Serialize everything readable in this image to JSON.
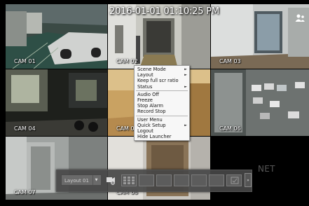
{
  "timestamp": "2016-01-01 01:10:25 PM",
  "cameras": [
    {
      "label": "CAM 01"
    },
    {
      "label": "CAM 02"
    },
    {
      "label": "CAM 03"
    },
    {
      "label": "CAM 04"
    },
    {
      "label": "CAM 05"
    },
    {
      "label": "CAM 06"
    },
    {
      "label": "CAM 07"
    },
    {
      "label": "CAM 08"
    }
  ],
  "context_menu": {
    "items": [
      {
        "label": "Scene Mode",
        "submenu": true
      },
      {
        "label": "Layout",
        "submenu": true
      },
      {
        "label": "Keep full scr ratio",
        "submenu": false
      },
      {
        "label": "Status",
        "submenu": true
      },
      {
        "label": "Audio Off",
        "submenu": false
      },
      {
        "label": "Freeze",
        "submenu": false
      },
      {
        "label": "Stop Alarm",
        "submenu": false
      },
      {
        "label": "Record Stop",
        "submenu": false
      },
      {
        "label": "User Menu",
        "submenu": false
      },
      {
        "label": "Quick Setup",
        "submenu": true
      },
      {
        "label": "Logout",
        "submenu": false
      },
      {
        "label": "Hide Launcher",
        "submenu": false
      }
    ],
    "submenu_arrow": "►"
  },
  "launcher": {
    "layout_value": "Layout 01",
    "expand_label": "»"
  },
  "watermark": "NET",
  "icons": [
    "user-icon",
    "camera-settings-icon",
    "grid-layout-icon",
    "chevron-down-icon",
    "expand-icon"
  ]
}
